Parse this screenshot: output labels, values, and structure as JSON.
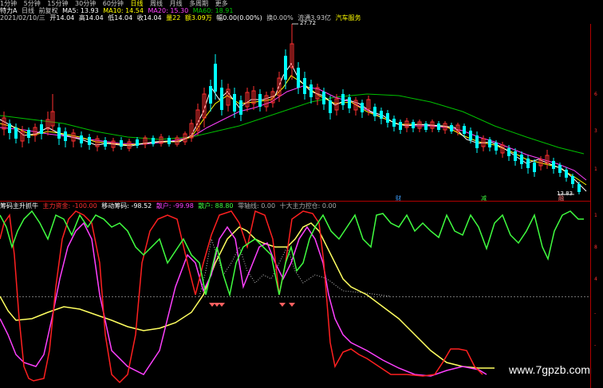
{
  "toolbar": {
    "items": [
      "1分钟",
      "5分钟",
      "15分钟",
      "30分钟",
      "60分钟",
      "日线",
      "周线",
      "月线",
      "多周期",
      "更多"
    ],
    "first_label": "..."
  },
  "stock": {
    "name": "特力A",
    "view": "日线",
    "adjust": "前复权",
    "ma5_label": "MA5: 13.93",
    "ma10_label": "MA10: 14.54",
    "ma20_label": "MA20: 15.30",
    "ma60_label": "MA60: 18.91",
    "high_mark": "27.72",
    "low_mark": "13.83"
  },
  "quote": {
    "date": "2021/02/10/三",
    "open": "开14.04",
    "high": "高14.04",
    "low": "低14.04",
    "close": "收14.04",
    "volume": "量22",
    "amount": "额3.09万",
    "change": "幅0.00(0.00%)",
    "turnover": "换0.00%",
    "float_value": "流通3.93亿",
    "sector": "汽车服务"
  },
  "indicator": {
    "name": "筹码主升抓牛",
    "main_fund": "主力资金: -100.00",
    "move_chip": "移动筹码: -98.52",
    "retail": "散户: -99.98",
    "retail2": "散户: 88.80",
    "zero_axis": "零轴线: 0.00",
    "big_control": "十大主力控仓: 0.00"
  },
  "markers": {
    "fin": "财",
    "sale": "减",
    "buy": "融"
  },
  "watermark": "www.7gpzb.com",
  "colors": {
    "up": "#ff3030",
    "down": "#00ffff",
    "ma5": "#ffffff",
    "ma10": "#ffff00",
    "ma20": "#ff40ff",
    "ma60": "#00c000",
    "green_line": "#40ff40",
    "yellow_line": "#ffff60",
    "magenta_line": "#ff40ff",
    "red_line": "#ff2020"
  }
}
